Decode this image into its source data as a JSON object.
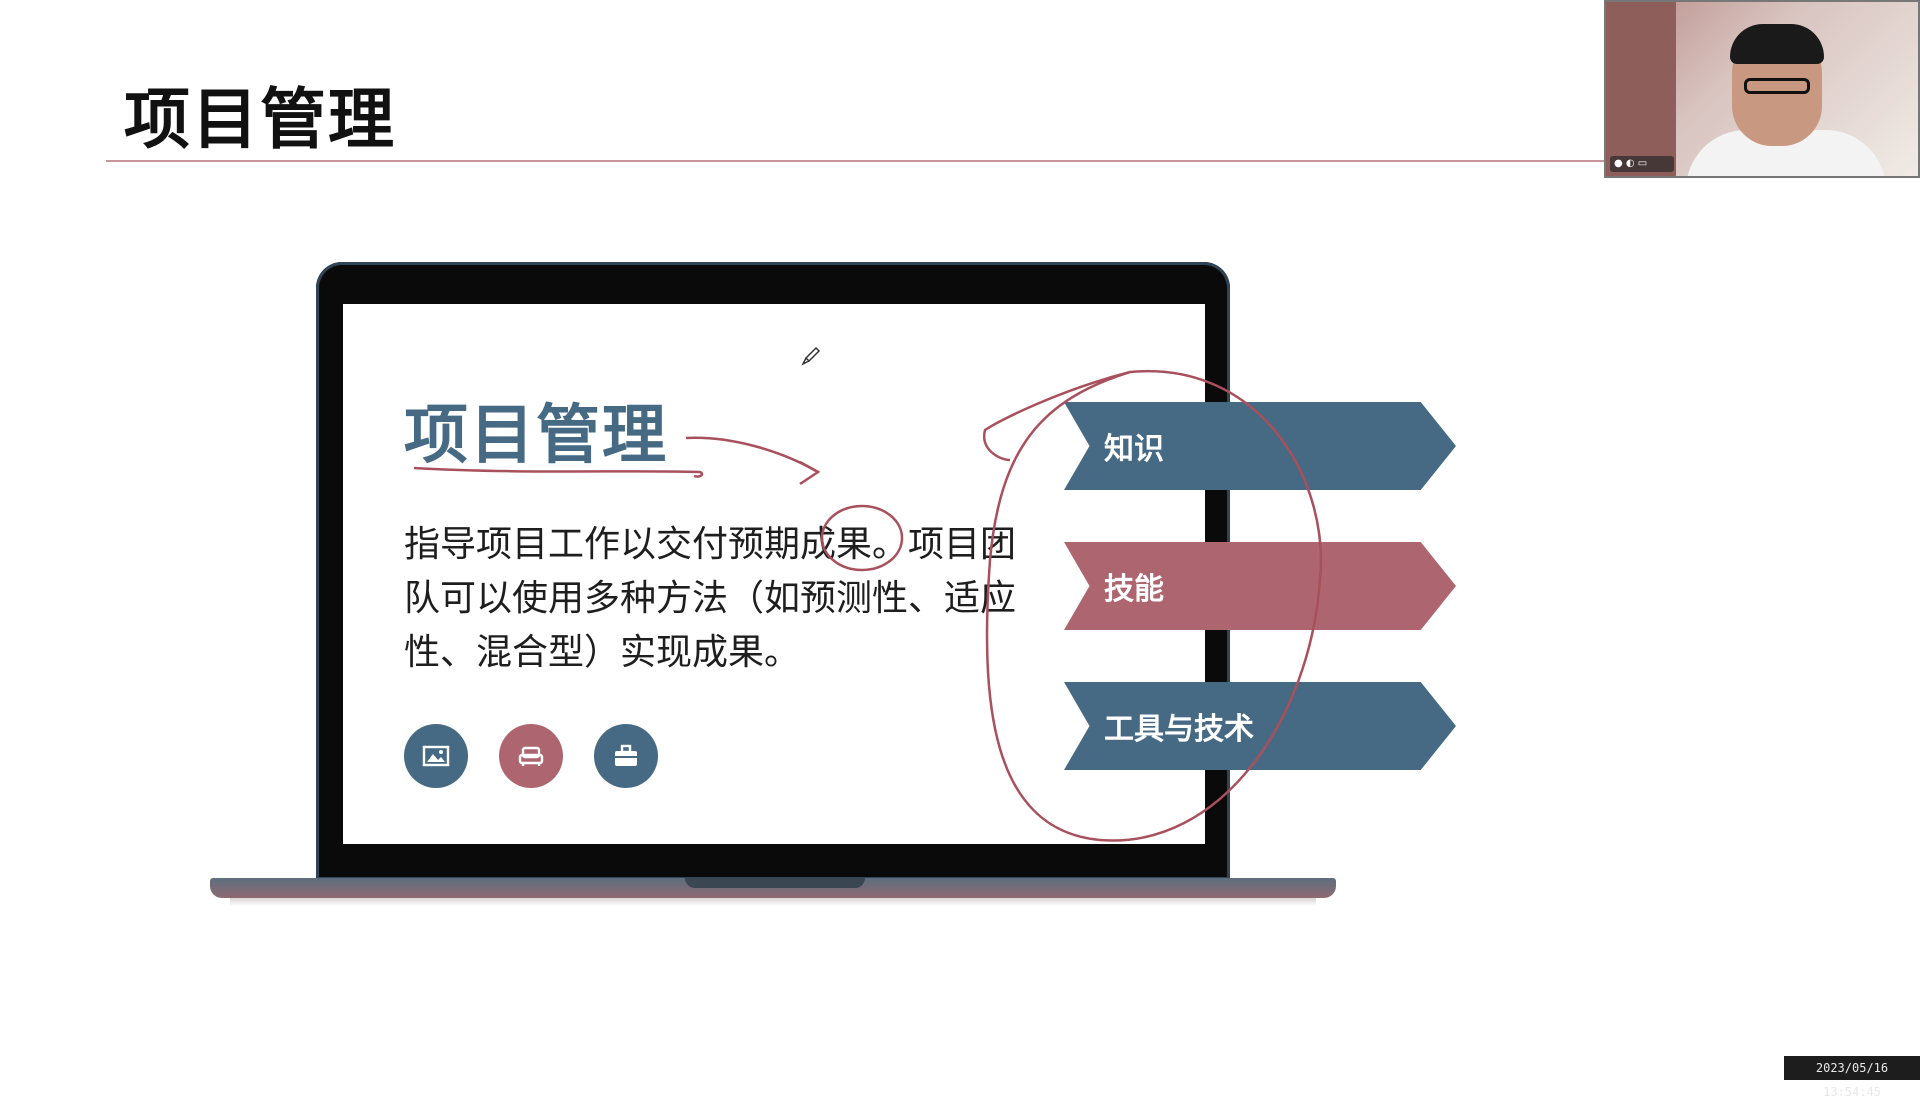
{
  "slide": {
    "title": "项目管理",
    "inner_title": "项目管理",
    "inner_body_lines": [
      "指导项目工作以交付预期成果。项目团",
      "队可以使用多种方法（如预测性、适应",
      "性、混合型）实现成果。"
    ],
    "icons": [
      "image-icon",
      "sofa-icon",
      "briefcase-icon"
    ],
    "banners": [
      "知识",
      "技能",
      "工具与技术"
    ]
  },
  "colors": {
    "blue": "#466a84",
    "red": "#ad666f",
    "ink": "#a8505c"
  },
  "recording": {
    "timestamp": "2023/05/16 13:54:45"
  }
}
